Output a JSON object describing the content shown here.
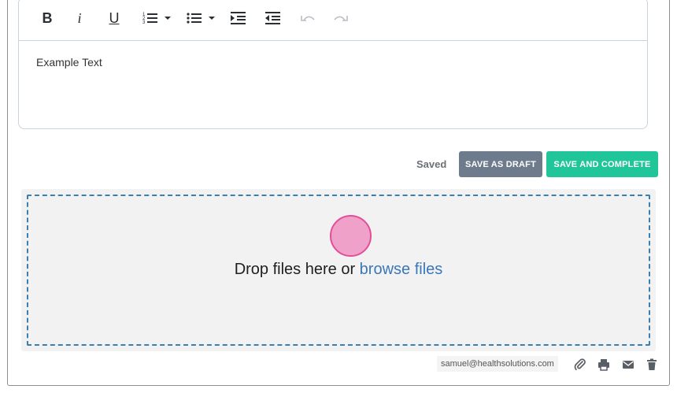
{
  "toolbar": {
    "bold": "B",
    "italic": "i",
    "underline": "U"
  },
  "editor": {
    "content": "Example Text"
  },
  "actions": {
    "status": "Saved",
    "save_draft": "SAVE AS DRAFT",
    "save_complete": "SAVE AND COMPLETE"
  },
  "dropzone": {
    "prefix": "Drop files here or ",
    "link": "browse files"
  },
  "footer": {
    "email": "samuel@healthsolutions.com"
  },
  "colors": {
    "draft_button": "#6e7b8d",
    "complete_button": "#21c59a",
    "link": "#3a78b8",
    "dropzone_border": "#3a7fb0"
  }
}
